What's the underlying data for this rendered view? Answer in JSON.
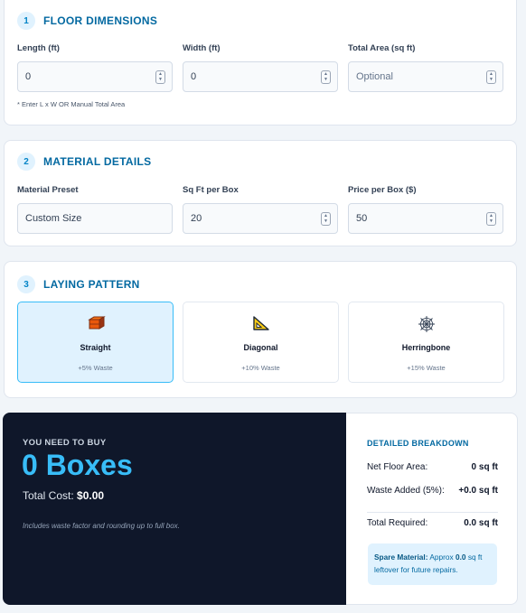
{
  "floor": {
    "step": "1",
    "title": "FLOOR DIMENSIONS",
    "length_label": "Length (ft)",
    "length_value": "0",
    "width_label": "Width (ft)",
    "width_value": "0",
    "area_label": "Total Area (sq ft)",
    "area_placeholder": "Optional",
    "hint": "* Enter L x W OR Manual Total Area"
  },
  "material": {
    "step": "2",
    "title": "MATERIAL DETAILS",
    "preset_label": "Material Preset",
    "preset_value": "Custom Size",
    "sqft_label": "Sq Ft per Box",
    "sqft_value": "20",
    "price_label": "Price per Box ($)",
    "price_value": "50"
  },
  "pattern": {
    "step": "3",
    "title": "LAYING PATTERN",
    "options": [
      {
        "name": "Straight",
        "waste": "+5% Waste",
        "icon": "brick-icon",
        "selected": true
      },
      {
        "name": "Diagonal",
        "waste": "+10% Waste",
        "icon": "triangle-ruler-icon",
        "selected": false
      },
      {
        "name": "Herringbone",
        "waste": "+15% Waste",
        "icon": "spider-web-icon",
        "selected": false
      }
    ]
  },
  "result": {
    "label": "YOU NEED TO BUY",
    "boxes": "0 Boxes",
    "cost_label": "Total Cost:",
    "cost_value": "$0.00",
    "note": "Includes waste factor and rounding up to full box."
  },
  "breakdown": {
    "title": "DETAILED BREAKDOWN",
    "net_label": "Net Floor Area:",
    "net_value": "0 sq ft",
    "waste_label": "Waste Added (5%):",
    "waste_value": "+0.0 sq ft",
    "total_label": "Total Required:",
    "total_value": "0.0 sq ft",
    "spare_label": "Spare Material:",
    "spare_pre": "Approx",
    "spare_value": "0.0",
    "spare_post": "sq ft leftover for future repairs."
  },
  "colors": {
    "accent": "#0284c7",
    "accent_dark": "#0369a1",
    "result_bg": "#0f172a",
    "result_highlight": "#38bdf8",
    "selected_bg": "#e0f2fe"
  }
}
